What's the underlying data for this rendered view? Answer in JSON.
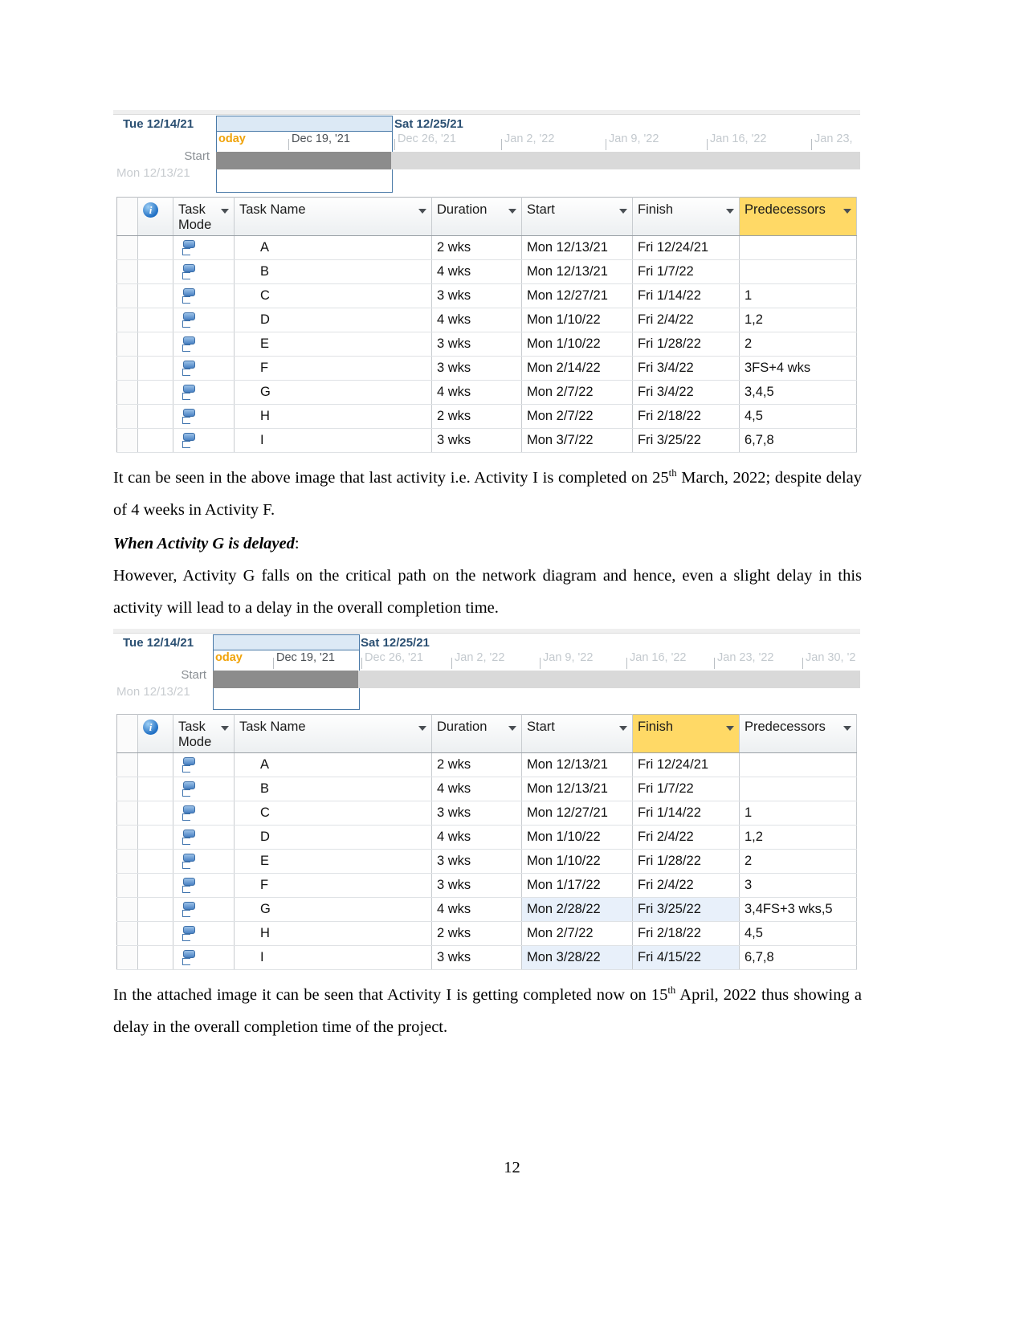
{
  "document": {
    "page_number": "12",
    "paragraph_1": "It can be seen in the above image that last activity i.e. Activity I is completed on 25",
    "paragraph_1_sup": "th",
    "paragraph_1_cont": " March, 2022; despite delay of 4 weeks in Activity F.",
    "heading_1": "When Activity G is delayed",
    "heading_1_colon": ":",
    "paragraph_2": "However, Activity G falls on the critical path on the network diagram and hence, even a slight delay in this activity will lead to a delay in the overall completion time.",
    "paragraph_3": "In the attached image it can be seen that Activity I is getting completed now on 15",
    "paragraph_3_sup": "th",
    "paragraph_3_cont": " April, 2022 thus showing a delay in the overall completion time of the project."
  },
  "colors": {
    "header_highlight": "#ffd966",
    "row_selection": "#e8f0fa",
    "today_marker": "#f0a30a",
    "timeline_box": "#dce9f5",
    "timeline_border": "#4a7aa8"
  },
  "gantt_1": {
    "timeline": {
      "left_date": "Tue 12/14/21",
      "right_date": "Sat 12/25/21",
      "start_label": "Start",
      "start_date": "Mon 12/13/21",
      "today_label": "oday",
      "ticks": [
        {
          "label": "Dec 19, '21",
          "dim": false
        },
        {
          "label": "Dec 26, '21",
          "dim": true
        },
        {
          "label": "Jan 2, '22",
          "dim": true
        },
        {
          "label": "Jan 9, '22",
          "dim": true
        },
        {
          "label": "Jan 16, '22",
          "dim": true
        },
        {
          "label": "Jan 23,",
          "dim": true
        }
      ]
    },
    "columns": [
      {
        "label": "",
        "key": "info",
        "highlight": false
      },
      {
        "label": "Task Mode",
        "key": "mode",
        "highlight": false
      },
      {
        "label": "Task Name",
        "key": "name",
        "highlight": false
      },
      {
        "label": "Duration",
        "key": "duration",
        "highlight": false
      },
      {
        "label": "Start",
        "key": "start",
        "highlight": false
      },
      {
        "label": "Finish",
        "key": "finish",
        "highlight": false
      },
      {
        "label": "Predecessors",
        "key": "predecessors",
        "highlight": true
      }
    ],
    "rows": [
      {
        "name": "A",
        "duration": "2 wks",
        "start": "Mon 12/13/21",
        "finish": "Fri 12/24/21",
        "predecessors": "",
        "selected": false
      },
      {
        "name": "B",
        "duration": "4 wks",
        "start": "Mon 12/13/21",
        "finish": "Fri 1/7/22",
        "predecessors": "",
        "selected": false
      },
      {
        "name": "C",
        "duration": "3 wks",
        "start": "Mon 12/27/21",
        "finish": "Fri 1/14/22",
        "predecessors": "1",
        "selected": false
      },
      {
        "name": "D",
        "duration": "4 wks",
        "start": "Mon 1/10/22",
        "finish": "Fri 2/4/22",
        "predecessors": "1,2",
        "selected": false
      },
      {
        "name": "E",
        "duration": "3 wks",
        "start": "Mon 1/10/22",
        "finish": "Fri 1/28/22",
        "predecessors": "2",
        "selected": false
      },
      {
        "name": "F",
        "duration": "3 wks",
        "start": "Mon 2/14/22",
        "finish": "Fri 3/4/22",
        "predecessors": "3FS+4 wks",
        "selected": false
      },
      {
        "name": "G",
        "duration": "4 wks",
        "start": "Mon 2/7/22",
        "finish": "Fri 3/4/22",
        "predecessors": "3,4,5",
        "selected": false
      },
      {
        "name": "H",
        "duration": "2 wks",
        "start": "Mon 2/7/22",
        "finish": "Fri 2/18/22",
        "predecessors": "4,5",
        "selected": false
      },
      {
        "name": "I",
        "duration": "3 wks",
        "start": "Mon 3/7/22",
        "finish": "Fri 3/25/22",
        "predecessors": "6,7,8",
        "selected": false
      }
    ]
  },
  "gantt_2": {
    "timeline": {
      "left_date": "Tue 12/14/21",
      "right_date": "Sat 12/25/21",
      "start_label": "Start",
      "start_date": "Mon 12/13/21",
      "today_label": "oday",
      "ticks": [
        {
          "label": "Dec 19, '21",
          "dim": false
        },
        {
          "label": "Dec 26, '21",
          "dim": true
        },
        {
          "label": "Jan 2, '22",
          "dim": true
        },
        {
          "label": "Jan 9, '22",
          "dim": true
        },
        {
          "label": "Jan 16, '22",
          "dim": true
        },
        {
          "label": "Jan 23, '22",
          "dim": true
        },
        {
          "label": "Jan 30, '2",
          "dim": true
        }
      ]
    },
    "columns": [
      {
        "label": "",
        "key": "info",
        "highlight": false
      },
      {
        "label": "Task Mode",
        "key": "mode",
        "highlight": false
      },
      {
        "label": "Task Name",
        "key": "name",
        "highlight": false
      },
      {
        "label": "Duration",
        "key": "duration",
        "highlight": false
      },
      {
        "label": "Start",
        "key": "start",
        "highlight": false
      },
      {
        "label": "Finish",
        "key": "finish",
        "highlight": true
      },
      {
        "label": "Predecessors",
        "key": "predecessors",
        "highlight": false
      }
    ],
    "rows": [
      {
        "name": "A",
        "duration": "2 wks",
        "start": "Mon 12/13/21",
        "finish": "Fri 12/24/21",
        "predecessors": "",
        "selected": false
      },
      {
        "name": "B",
        "duration": "4 wks",
        "start": "Mon 12/13/21",
        "finish": "Fri 1/7/22",
        "predecessors": "",
        "selected": false
      },
      {
        "name": "C",
        "duration": "3 wks",
        "start": "Mon 12/27/21",
        "finish": "Fri 1/14/22",
        "predecessors": "1",
        "selected": false
      },
      {
        "name": "D",
        "duration": "4 wks",
        "start": "Mon 1/10/22",
        "finish": "Fri 2/4/22",
        "predecessors": "1,2",
        "selected": false
      },
      {
        "name": "E",
        "duration": "3 wks",
        "start": "Mon 1/10/22",
        "finish": "Fri 1/28/22",
        "predecessors": "2",
        "selected": false
      },
      {
        "name": "F",
        "duration": "3 wks",
        "start": "Mon 1/17/22",
        "finish": "Fri 2/4/22",
        "predecessors": "3",
        "selected": false
      },
      {
        "name": "G",
        "duration": "4 wks",
        "start": "Mon 2/28/22",
        "finish": "Fri 3/25/22",
        "predecessors": "3,4FS+3 wks,5",
        "selected": true
      },
      {
        "name": "H",
        "duration": "2 wks",
        "start": "Mon 2/7/22",
        "finish": "Fri 2/18/22",
        "predecessors": "4,5",
        "selected": false
      },
      {
        "name": "I",
        "duration": "3 wks",
        "start": "Mon 3/28/22",
        "finish": "Fri 4/15/22",
        "predecessors": "6,7,8",
        "selected": true
      }
    ]
  }
}
